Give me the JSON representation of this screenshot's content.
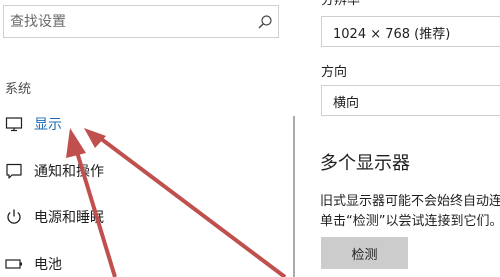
{
  "search": {
    "placeholder": "查找设置"
  },
  "sidebar": {
    "section_label": "系统",
    "items": [
      {
        "label": "显示",
        "icon": "monitor-icon",
        "selected": true
      },
      {
        "label": "通知和操作",
        "icon": "notification-icon",
        "selected": false
      },
      {
        "label": "电源和睡眠",
        "icon": "power-icon",
        "selected": false
      },
      {
        "label": "电池",
        "icon": "battery-icon",
        "selected": false
      }
    ]
  },
  "main": {
    "resolution_label": "分辨率",
    "resolution_value": "1024 × 768 (推荐)",
    "orientation_label": "方向",
    "orientation_value": "横向",
    "multi_display_title": "多个显示器",
    "multi_display_desc": "旧式显示器可能不会始终自动连接。单击“检测”以尝试连接到它们。",
    "multi_display_desc_visible": "旧式显示器可能不会始终自动连接。单击“检测”以尝试连接到它们。",
    "detect_button": "检测"
  },
  "colors": {
    "accent": "#1b6cb3",
    "annotation_arrow": "#c0504d",
    "button_bg": "#cccccc"
  }
}
